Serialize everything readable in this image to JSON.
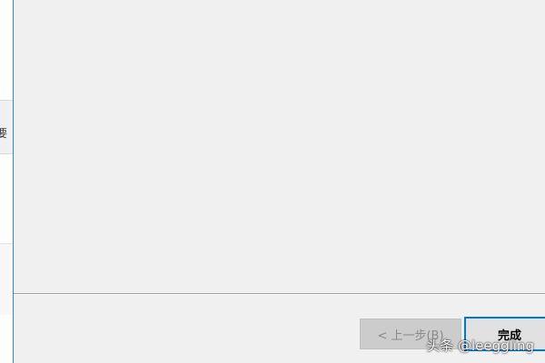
{
  "background_window": {
    "tab_glyph": "要"
  },
  "wizard": {
    "buttons": {
      "back_label": "< 上一步(B)",
      "finish_label": "完成"
    }
  },
  "watermark": {
    "text": "头条 @leeggling"
  },
  "colors": {
    "dialog_bg": "#f0f0f0",
    "accent_blue": "#0078d7",
    "disabled_text": "#8a8a8a"
  }
}
